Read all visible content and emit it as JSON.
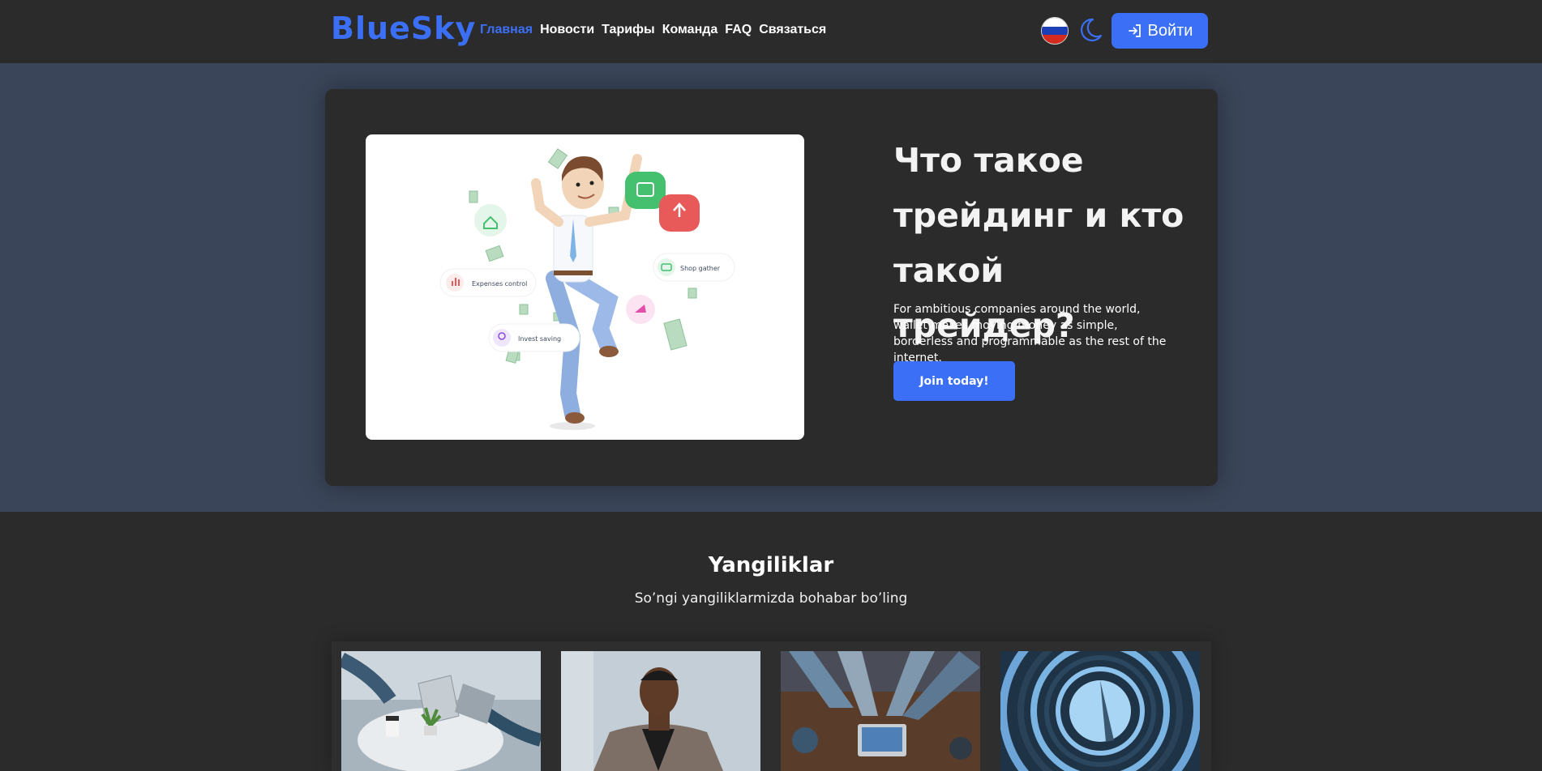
{
  "brand": {
    "logo_text": "BlueSky",
    "accent_color": "#3b6ff5"
  },
  "nav": {
    "items": [
      {
        "label": "Главная",
        "active": true
      },
      {
        "label": "Новости",
        "active": false
      },
      {
        "label": "Тарифы",
        "active": false
      },
      {
        "label": "Команда",
        "active": false
      },
      {
        "label": "FAQ",
        "active": false
      },
      {
        "label": "Связаться",
        "active": false
      }
    ]
  },
  "header": {
    "language_icon": "russia-flag-icon",
    "theme_icon": "moon-icon",
    "login_icon": "login-arrow-icon",
    "login_label": "Войти"
  },
  "hero": {
    "title": "Что такое трейдинг и кто такой трейдер?",
    "text": "For ambitious companies around the world, wallet makes moving money as simple, borderless and programmable as the rest of the internet.",
    "cta_label": "Join today!",
    "illustration": {
      "labels": {
        "expenses": "Expenses control",
        "shop": "Shop gather",
        "invest": "Invest saving"
      }
    }
  },
  "news": {
    "title": "Yangiliklar",
    "subtitle": "So’ngi yangiliklarmizda bohabar bo’ling",
    "cards": [
      {
        "image": "office-laptops-photo"
      },
      {
        "image": "businessman-portrait-photo"
      },
      {
        "image": "team-hands-laptop-photo"
      },
      {
        "image": "spiral-building-photo"
      }
    ]
  }
}
